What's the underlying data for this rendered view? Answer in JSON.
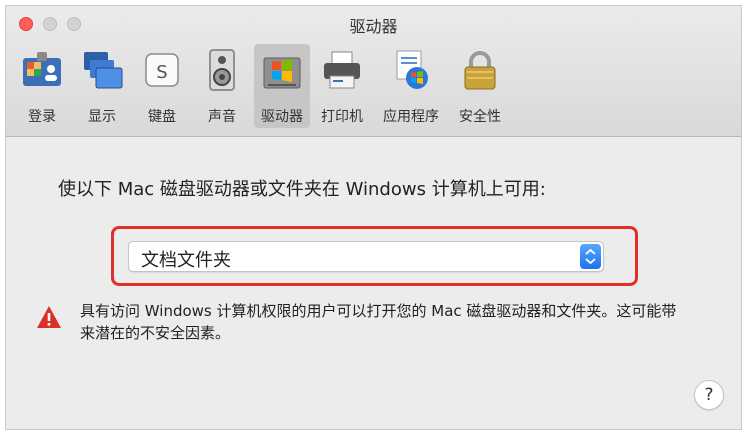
{
  "window": {
    "title": "驱动器"
  },
  "toolbar": {
    "tabs": [
      {
        "label": "登录",
        "icon": "login-user-card-icon"
      },
      {
        "label": "显示",
        "icon": "display-monitors-icon"
      },
      {
        "label": "键盘",
        "icon": "keyboard-key-icon"
      },
      {
        "label": "声音",
        "icon": "speaker-icon"
      },
      {
        "label": "驱动器",
        "icon": "drive-windows-icon",
        "selected": true
      },
      {
        "label": "打印机",
        "icon": "printer-icon"
      },
      {
        "label": "应用程序",
        "icon": "applications-windows-icon"
      },
      {
        "label": "安全性",
        "icon": "lock-icon"
      }
    ],
    "keyboard_key_glyph": "S"
  },
  "content": {
    "heading": "使以下 Mac 磁盘驱动器或文件夹在 Windows 计算机上可用:",
    "select": {
      "value": "文档文件夹"
    },
    "warning": "具有访问 Windows 计算机权限的用户可以打开您的 Mac 磁盘驱动器和文件夹。这可能带来潜在的不安全因素。",
    "help_label": "?"
  },
  "colors": {
    "highlight_border": "#e0302a",
    "warning": "#d9302a",
    "select_accent": "#1a73e8"
  }
}
